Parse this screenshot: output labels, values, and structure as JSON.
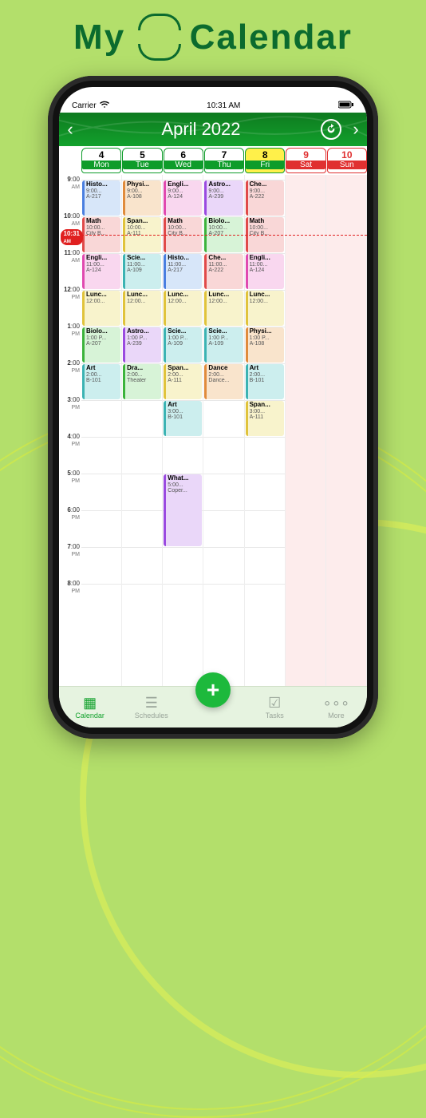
{
  "app_name_left": "My",
  "app_name_right": "Calendar",
  "statusbar": {
    "carrier": "Carrier",
    "time": "10:31 AM"
  },
  "header": {
    "title": "April 2022"
  },
  "now": {
    "label": "10:31",
    "ap": "AM",
    "row": 1.51
  },
  "days": [
    {
      "num": "4",
      "name": "Mon",
      "weekend": false,
      "today": false
    },
    {
      "num": "5",
      "name": "Tue",
      "weekend": false,
      "today": false
    },
    {
      "num": "6",
      "name": "Wed",
      "weekend": false,
      "today": false
    },
    {
      "num": "7",
      "name": "Thu",
      "weekend": false,
      "today": false
    },
    {
      "num": "8",
      "name": "Fri",
      "weekend": false,
      "today": true
    },
    {
      "num": "9",
      "name": "Sat",
      "weekend": true,
      "today": false
    },
    {
      "num": "10",
      "name": "Sun",
      "weekend": true,
      "today": false
    }
  ],
  "hours": [
    {
      "h": "9",
      "m": ":00",
      "ap": "AM"
    },
    {
      "h": "10",
      "m": ":00",
      "ap": "AM"
    },
    {
      "h": "11",
      "m": ":00",
      "ap": "AM"
    },
    {
      "h": "12",
      "m": ":00",
      "ap": "PM"
    },
    {
      "h": "1",
      "m": ":00",
      "ap": "PM"
    },
    {
      "h": "2",
      "m": ":00",
      "ap": "PM"
    },
    {
      "h": "3",
      "m": ":00",
      "ap": "PM"
    },
    {
      "h": "4",
      "m": ":00",
      "ap": "PM"
    },
    {
      "h": "5",
      "m": ":00",
      "ap": "PM"
    },
    {
      "h": "6",
      "m": ":00",
      "ap": "PM"
    },
    {
      "h": "7",
      "m": ":00",
      "ap": "PM"
    },
    {
      "h": "8",
      "m": ":00",
      "ap": "PM"
    }
  ],
  "colors": {
    "red": {
      "bg": "#f9d7d7",
      "bd": "#e04a4a"
    },
    "blue": {
      "bg": "#d7e6f9",
      "bd": "#4a7fe0"
    },
    "green": {
      "bg": "#d7f3d7",
      "bd": "#3cb33c"
    },
    "yellow": {
      "bg": "#f8f3cc",
      "bd": "#e0c33c"
    },
    "orange": {
      "bg": "#f9e4cc",
      "bd": "#e08b3c"
    },
    "purple": {
      "bg": "#ead7f9",
      "bd": "#9a4ae0"
    },
    "pink": {
      "bg": "#f9d7ef",
      "bd": "#e04ab0"
    },
    "teal": {
      "bg": "#cceeee",
      "bd": "#3cb3b3"
    }
  },
  "events": [
    {
      "day": 0,
      "start": 0,
      "dur": 1,
      "color": "blue",
      "title": "Histo...",
      "time": "9:00...",
      "room": "A-217"
    },
    {
      "day": 0,
      "start": 1,
      "dur": 1,
      "color": "red",
      "title": "Math",
      "time": "10:00...",
      "room": "City B..."
    },
    {
      "day": 0,
      "start": 2,
      "dur": 1,
      "color": "pink",
      "title": "Engli...",
      "time": "11:00...",
      "room": "A-124"
    },
    {
      "day": 0,
      "start": 3,
      "dur": 1,
      "color": "yellow",
      "title": "Lunc...",
      "time": "12:00...",
      "room": ""
    },
    {
      "day": 0,
      "start": 4,
      "dur": 1,
      "color": "green",
      "title": "Biolo...",
      "time": "1:00 P...",
      "room": "A-207"
    },
    {
      "day": 0,
      "start": 5,
      "dur": 1,
      "color": "teal",
      "title": "Art",
      "time": "2:00...",
      "room": "B-101"
    },
    {
      "day": 1,
      "start": 0,
      "dur": 1,
      "color": "orange",
      "title": "Physi...",
      "time": "9:00...",
      "room": "A-108"
    },
    {
      "day": 1,
      "start": 1,
      "dur": 1,
      "color": "yellow",
      "title": "Span...",
      "time": "10:00...",
      "room": "A-111"
    },
    {
      "day": 1,
      "start": 2,
      "dur": 1,
      "color": "teal",
      "title": "Scie...",
      "time": "11:00...",
      "room": "A-109"
    },
    {
      "day": 1,
      "start": 3,
      "dur": 1,
      "color": "yellow",
      "title": "Lunc...",
      "time": "12:00...",
      "room": ""
    },
    {
      "day": 1,
      "start": 4,
      "dur": 1,
      "color": "purple",
      "title": "Astro...",
      "time": "1:00 P...",
      "room": "A-239"
    },
    {
      "day": 1,
      "start": 5,
      "dur": 1,
      "color": "green",
      "title": "Dra...",
      "time": "2:00...",
      "room": "Theater"
    },
    {
      "day": 2,
      "start": 0,
      "dur": 1,
      "color": "pink",
      "title": "Engli...",
      "time": "9:00...",
      "room": "A-124"
    },
    {
      "day": 2,
      "start": 1,
      "dur": 1,
      "color": "red",
      "title": "Math",
      "time": "10:00...",
      "room": "City B..."
    },
    {
      "day": 2,
      "start": 2,
      "dur": 1,
      "color": "blue",
      "title": "Histo...",
      "time": "11:00...",
      "room": "A-217"
    },
    {
      "day": 2,
      "start": 3,
      "dur": 1,
      "color": "yellow",
      "title": "Lunc...",
      "time": "12:00...",
      "room": ""
    },
    {
      "day": 2,
      "start": 4,
      "dur": 1,
      "color": "teal",
      "title": "Scie...",
      "time": "1:00 P...",
      "room": "A-109"
    },
    {
      "day": 2,
      "start": 5,
      "dur": 1,
      "color": "yellow",
      "title": "Span...",
      "time": "2:00...",
      "room": "A-111"
    },
    {
      "day": 2,
      "start": 6,
      "dur": 1,
      "color": "teal",
      "title": "Art",
      "time": "3:00...",
      "room": "B-101"
    },
    {
      "day": 2,
      "start": 8,
      "dur": 2,
      "color": "purple",
      "title": "What...",
      "time": "5:00...",
      "room": "Coper..."
    },
    {
      "day": 3,
      "start": 0,
      "dur": 1,
      "color": "purple",
      "title": "Astro...",
      "time": "9:00...",
      "room": "A-239"
    },
    {
      "day": 3,
      "start": 1,
      "dur": 1,
      "color": "green",
      "title": "Biolo...",
      "time": "10:00...",
      "room": "A-207"
    },
    {
      "day": 3,
      "start": 2,
      "dur": 1,
      "color": "red",
      "title": "Che...",
      "time": "11:00...",
      "room": "A-222"
    },
    {
      "day": 3,
      "start": 3,
      "dur": 1,
      "color": "yellow",
      "title": "Lunc...",
      "time": "12:00...",
      "room": ""
    },
    {
      "day": 3,
      "start": 4,
      "dur": 1,
      "color": "teal",
      "title": "Scie...",
      "time": "1:00 P...",
      "room": "A-109"
    },
    {
      "day": 3,
      "start": 5,
      "dur": 1,
      "color": "orange",
      "title": "Dance",
      "time": "2:00...",
      "room": "Dance..."
    },
    {
      "day": 4,
      "start": 0,
      "dur": 1,
      "color": "red",
      "title": "Che...",
      "time": "9:00...",
      "room": "A-222"
    },
    {
      "day": 4,
      "start": 1,
      "dur": 1,
      "color": "red",
      "title": "Math",
      "time": "10:00...",
      "room": "City B..."
    },
    {
      "day": 4,
      "start": 2,
      "dur": 1,
      "color": "pink",
      "title": "Engli...",
      "time": "11:00...",
      "room": "A-124"
    },
    {
      "day": 4,
      "start": 3,
      "dur": 1,
      "color": "yellow",
      "title": "Lunc...",
      "time": "12:00...",
      "room": ""
    },
    {
      "day": 4,
      "start": 4,
      "dur": 1,
      "color": "orange",
      "title": "Physi...",
      "time": "1:00 P...",
      "room": "A-108"
    },
    {
      "day": 4,
      "start": 5,
      "dur": 1,
      "color": "teal",
      "title": "Art",
      "time": "2:00...",
      "room": "B-101"
    },
    {
      "day": 4,
      "start": 6,
      "dur": 1,
      "color": "yellow",
      "title": "Span...",
      "time": "3:00...",
      "room": "A-111"
    }
  ],
  "tabs": {
    "calendar": "Calendar",
    "schedules": "Schedules",
    "tasks": "Tasks",
    "more": "More"
  }
}
